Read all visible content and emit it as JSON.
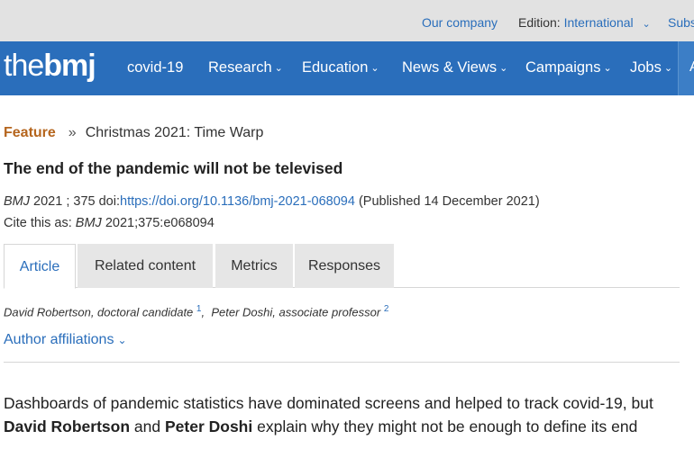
{
  "utility": {
    "our_company": "Our company",
    "edition_label": "Edition:",
    "edition_value": "International",
    "subscribe_partial": "Subs"
  },
  "nav": {
    "logo_thin": "the",
    "logo_bold": "bmj",
    "items": [
      {
        "label": "covid-19",
        "dropdown": false
      },
      {
        "label": "Research",
        "dropdown": true
      },
      {
        "label": "Education",
        "dropdown": true
      },
      {
        "label": "News & Views",
        "dropdown": true
      },
      {
        "label": "Campaigns",
        "dropdown": true
      },
      {
        "label": "Jobs",
        "dropdown": true
      }
    ],
    "edge_label": "A"
  },
  "breadcrumb": {
    "section": "Feature",
    "separator": "»",
    "issue": "Christmas 2021: Time Warp"
  },
  "article": {
    "title": "The end of the pandemic will not be televised",
    "journal": "BMJ",
    "year_vol": "2021 ; 375",
    "doi_label": "doi:",
    "doi": "https://doi.org/10.1136/bmj-2021-068094",
    "published": "(Published 14 December 2021)",
    "cite_label": "Cite this as:",
    "cite_journal": "BMJ",
    "cite_ref": "2021;375:e068094"
  },
  "tabs": [
    {
      "label": "Article",
      "active": true
    },
    {
      "label": "Related content",
      "active": false
    },
    {
      "label": "Metrics",
      "active": false
    },
    {
      "label": "Responses",
      "active": false
    }
  ],
  "authors": [
    {
      "text": "David Robertson, doctoral candidate",
      "sup": "1"
    },
    {
      "text": "Peter Doshi, associate professor",
      "sup": "2"
    }
  ],
  "author_affiliations": "Author affiliations",
  "standfirst": {
    "line1": "Dashboards of pandemic statistics have dominated screens and helped to track covid-19, but",
    "author1": "David Robertson",
    "and": "and",
    "author2": "Peter Doshi",
    "line2_rest": "explain why they might not be enough to define its end"
  },
  "colors": {
    "brand_blue": "#2a6ebb",
    "feature_orange": "#b5651d",
    "utility_bg": "#e2e2e2"
  },
  "icons": [
    "chevron-down-icon",
    "nav-caret-icon"
  ]
}
